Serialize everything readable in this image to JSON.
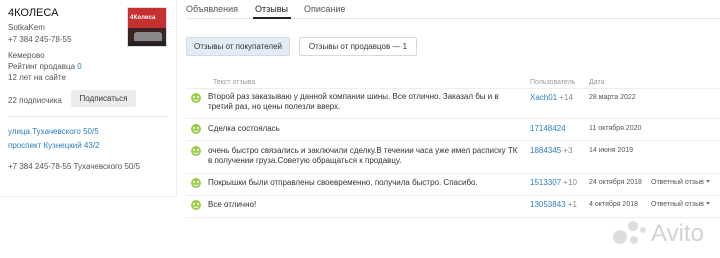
{
  "seller": {
    "name": "4КОЛЕСА",
    "login": "SotkaKem",
    "phone": "+7 384 245-78-55",
    "logo_text": "4Колеса",
    "city": "Кемерово",
    "rating_label": "Рейтинг продавца",
    "rating_value": "0",
    "years": "12 лет на сайте",
    "subscribers": "22 подписчика",
    "subscribe_label": "Подписаться",
    "addresses": [
      "улица Тухачевского 50/5",
      "проспект Кузнецкий 43/2"
    ],
    "phone_address": "+7 384 245-78-55 Тухачевского 50/5"
  },
  "tabs": [
    {
      "label": "Объявления"
    },
    {
      "label": "Отзывы",
      "active": true
    },
    {
      "label": "Описание"
    }
  ],
  "filters": {
    "buyers_label": "Отзывы от покупателей",
    "sellers_label": "Отзывы от продавцов — 1"
  },
  "table": {
    "columns": [
      "Текст отзыва",
      "Пользователь",
      "Дата"
    ],
    "reply_label": "Ответный отзыв",
    "rows": [
      {
        "text": "Второй раз заказываю у данной компании шины. Все отлично. Заказал бы и в третий раз, но цены полезли вверх.",
        "user": "Xach01",
        "count": "+14",
        "date": "28 марта 2022",
        "reply": false
      },
      {
        "text": "Сделка состоялась",
        "user": "17148424",
        "count": "",
        "date": "11 октября 2020",
        "reply": false
      },
      {
        "text": "очень быстро связались и заключили сделку.В течении часа уже имел расписку ТК в получении груза.Советую обращаться к продавцу.",
        "user": "1884345",
        "count": "+3",
        "date": "14 июня 2019",
        "reply": false
      },
      {
        "text": "Покрышки были отправлены своевременно, получила быстро. Спасибо.",
        "user": "1513307",
        "count": "+10",
        "date": "24 октября 2018",
        "reply": true
      },
      {
        "text": "Все отлично!",
        "user": "13053843",
        "count": "+1",
        "date": "4 октября 2018",
        "reply": true
      }
    ]
  },
  "watermark": "Avito",
  "colors": {
    "link": "#2b7ec1",
    "positive": "#9bcc4a",
    "filter_active": "#e3ebf4"
  }
}
